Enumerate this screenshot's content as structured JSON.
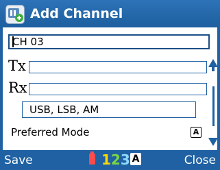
{
  "window": {
    "title": "Add Channel",
    "icon": "radio-channel-icon"
  },
  "form": {
    "channel_name": {
      "value": "CH 03"
    },
    "tx": {
      "label": "Tx",
      "value": ""
    },
    "rx": {
      "label": "Rx",
      "value": ""
    },
    "modes_value": "USB, LSB, AM",
    "preferred_mode": {
      "label": "Preferred Mode",
      "key_hint": "A"
    }
  },
  "softkeys": {
    "left": "Save",
    "right": "Close"
  },
  "status": {
    "input_mode_digits": [
      "1",
      "2",
      "3"
    ],
    "case_indicator": "A",
    "colors": {
      "battery": "#ff4b4b",
      "digit1": "#ffd900",
      "digit2": "#7cd642",
      "digit3": "#8fd7ff",
      "bar": "#1f61a2"
    }
  }
}
